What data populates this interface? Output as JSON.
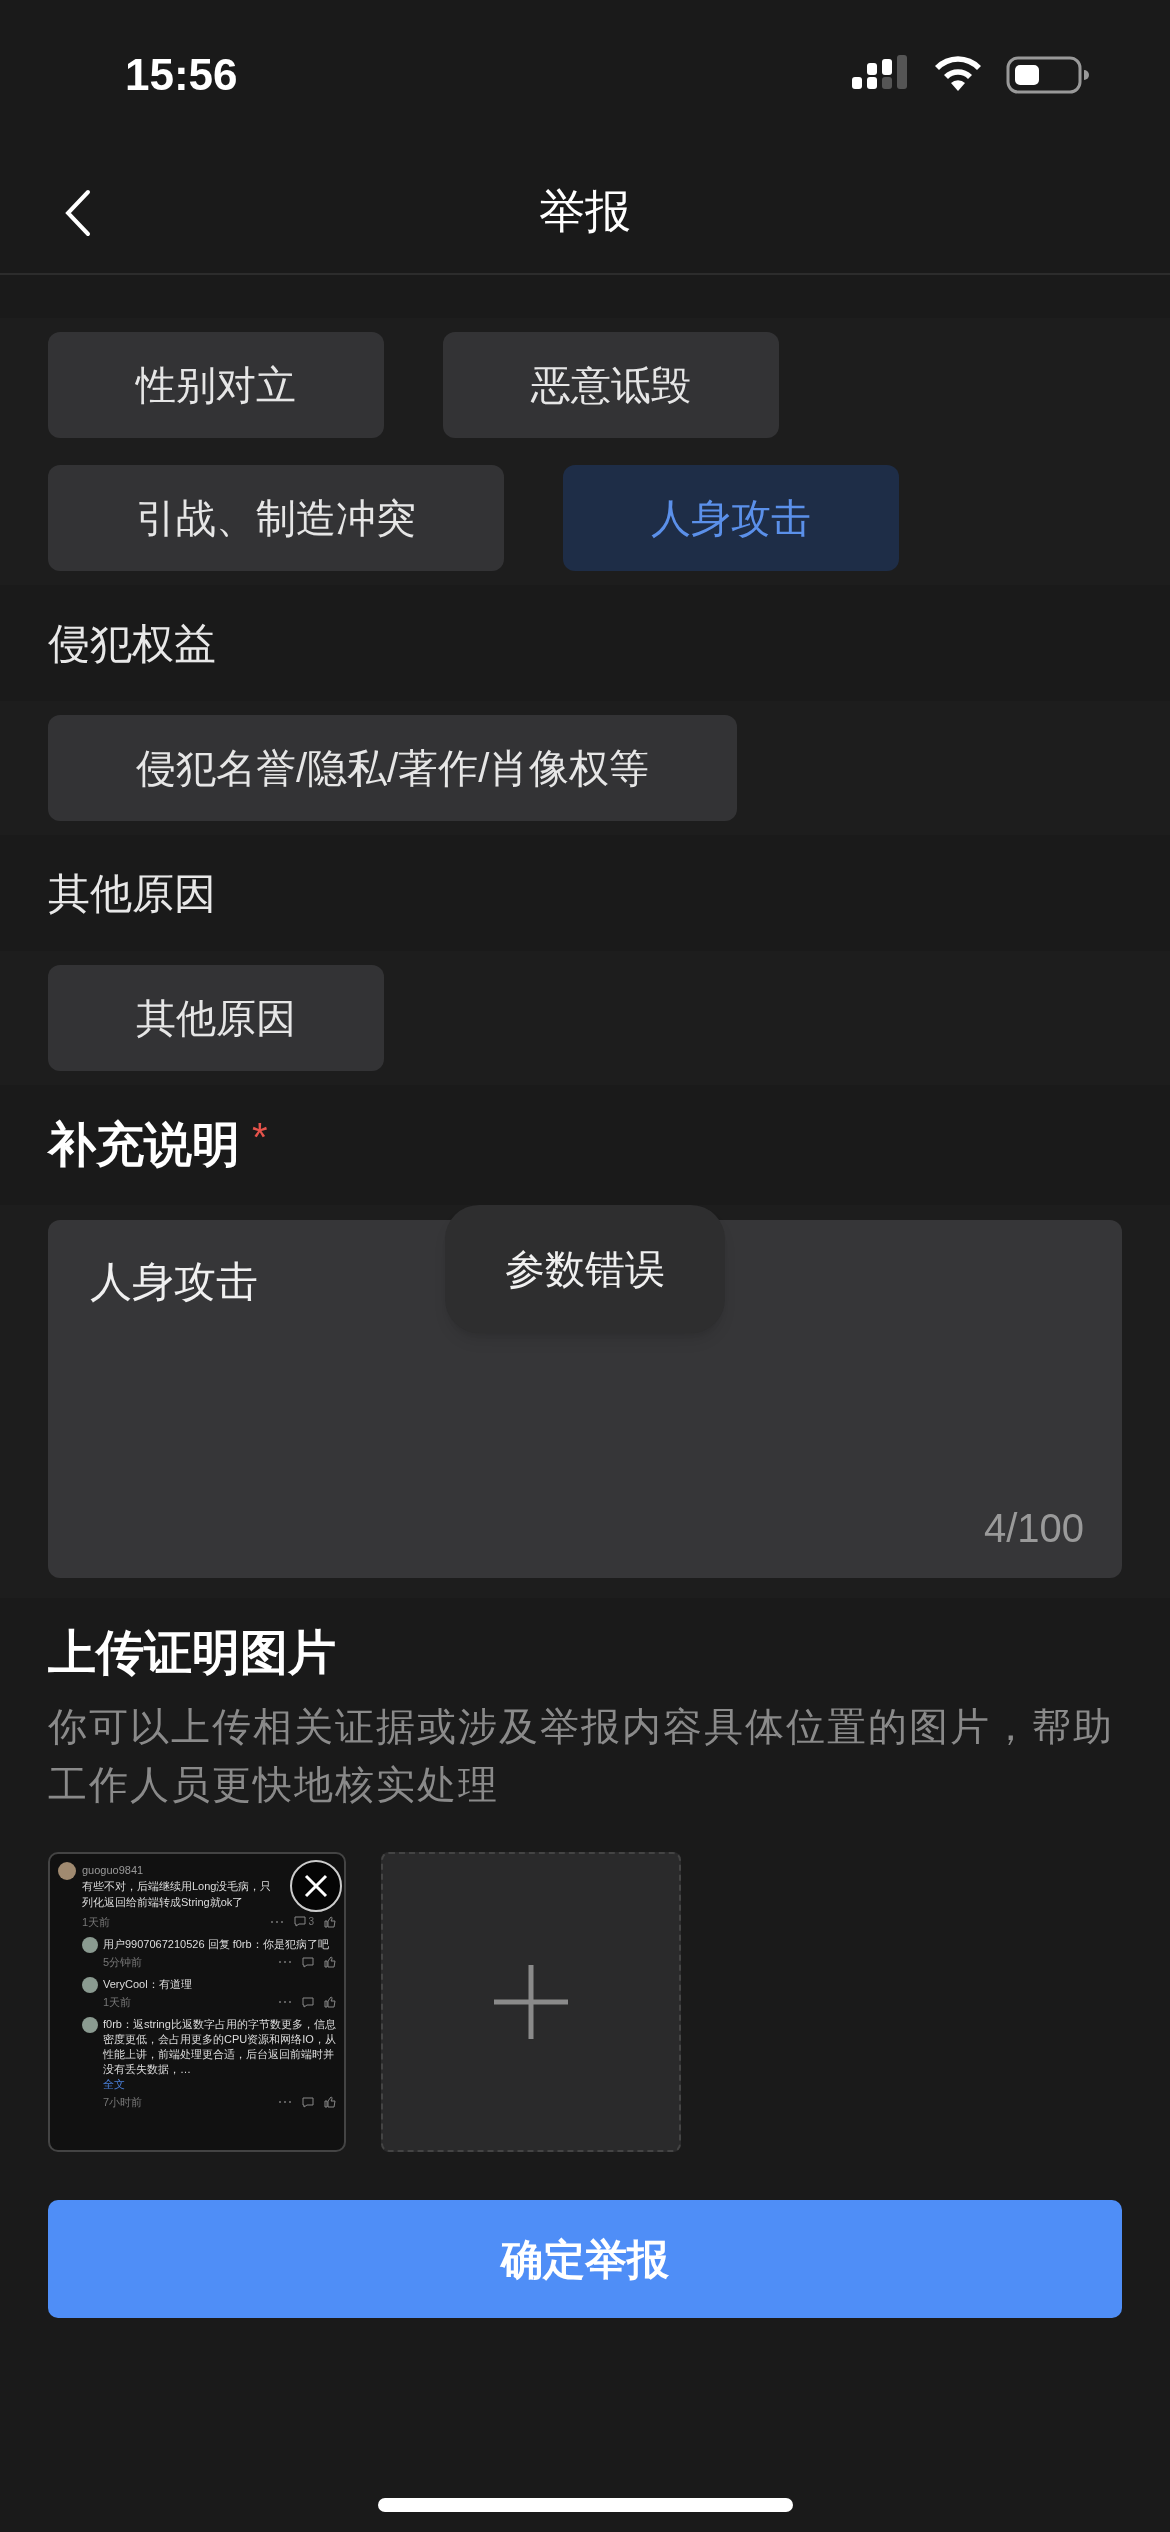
{
  "status_bar": {
    "time": "15:56"
  },
  "nav": {
    "title": "举报"
  },
  "groups": [
    {
      "options": [
        {
          "label": "性别对立",
          "selected": false
        },
        {
          "label": "恶意诋毁",
          "selected": false
        },
        {
          "label": "引战、制造冲突",
          "selected": false
        },
        {
          "label": "人身攻击",
          "selected": true
        }
      ]
    },
    {
      "title": "侵犯权益",
      "options": [
        {
          "label": "侵犯名誉/隐私/著作/肖像权等",
          "selected": false
        }
      ]
    },
    {
      "title": "其他原因",
      "options": [
        {
          "label": "其他原因",
          "selected": false
        }
      ]
    }
  ],
  "note": {
    "title": "补充说明",
    "required": true,
    "required_mark": "*",
    "value": "人身攻击",
    "counter": "4/100"
  },
  "toast": {
    "text": "参数错误"
  },
  "upload": {
    "title": "上传证明图片",
    "description": "你可以上传相关证据或涉及举报内容具体位置的图片，帮助工作人员更快地核实处理",
    "images": [
      {
        "comments": [
          {
            "user": "guoguo9841",
            "text": "有些不对，后端继续用Long没毛病，只列化返回给前端转成String就ok了",
            "time": "1天前",
            "count": "3",
            "children": [
              {
                "text": "用户9907067210526 回复 f0rb：你是犯病了吧",
                "time": "5分钟前"
              },
              {
                "text": "VeryCool：有道理",
                "time": "1天前"
              },
              {
                "text": "f0rb：返string比返数字占用的字节数更多，信息密度更低，会占用更多的CPU资源和网络IO，从性能上讲，前端处理更合适，后台返回前端时并没有丢失数据，…",
                "more": "全文",
                "time": "7小时前"
              }
            ]
          }
        ]
      }
    ]
  },
  "submit": {
    "label": "确定举报"
  }
}
